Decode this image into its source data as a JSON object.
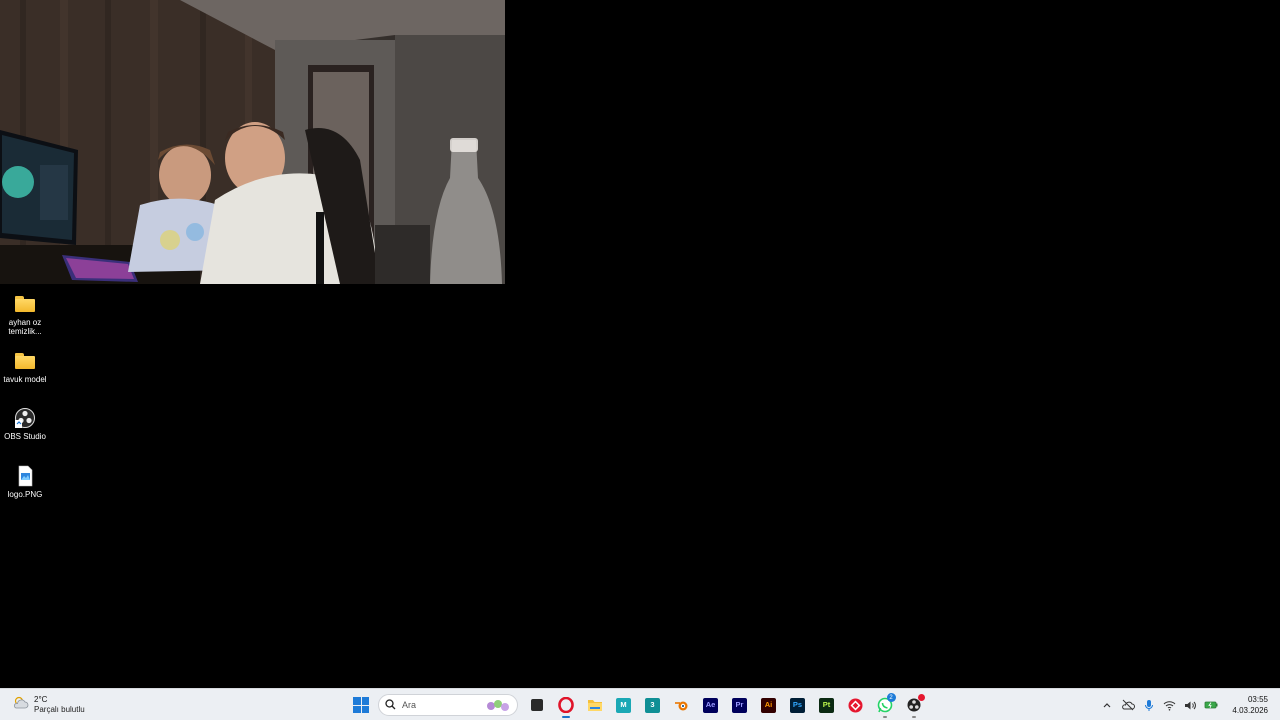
{
  "webcam": {
    "icon": "camera-feed"
  },
  "desktop": {
    "icons": [
      {
        "label": "ayhan oz temizlik...",
        "icon": "folder-icon"
      },
      {
        "label": "tavuk model",
        "icon": "folder-icon"
      },
      {
        "label": "OBS Studio",
        "icon": "obs-icon"
      },
      {
        "label": "logo.PNG",
        "icon": "image-file-icon"
      }
    ]
  },
  "taskbar": {
    "weather": {
      "temp": "2°C",
      "desc": "Parçalı bulutlu"
    },
    "search": {
      "placeholder": "Ara"
    },
    "apps": [
      {
        "name": "file-manager",
        "label": ""
      },
      {
        "name": "opera",
        "label": ""
      },
      {
        "name": "file-explorer",
        "label": ""
      },
      {
        "name": "maya",
        "label": "M"
      },
      {
        "name": "3ds-max",
        "label": "3"
      },
      {
        "name": "blender",
        "label": ""
      },
      {
        "name": "after-effects",
        "label": "Ae"
      },
      {
        "name": "premiere-pro",
        "label": "Pr"
      },
      {
        "name": "illustrator",
        "label": "Ai"
      },
      {
        "name": "photoshop",
        "label": "Ps"
      },
      {
        "name": "painter",
        "label": "Pt"
      },
      {
        "name": "anydesk",
        "label": ""
      },
      {
        "name": "whatsapp",
        "label": "",
        "badge": "2"
      },
      {
        "name": "obs",
        "label": ""
      }
    ],
    "clock": {
      "time": "03:55",
      "date": "4.03.2026"
    },
    "colors": {
      "accent": "#1e7bd8",
      "taskbar_bg": "#eceff3"
    }
  }
}
